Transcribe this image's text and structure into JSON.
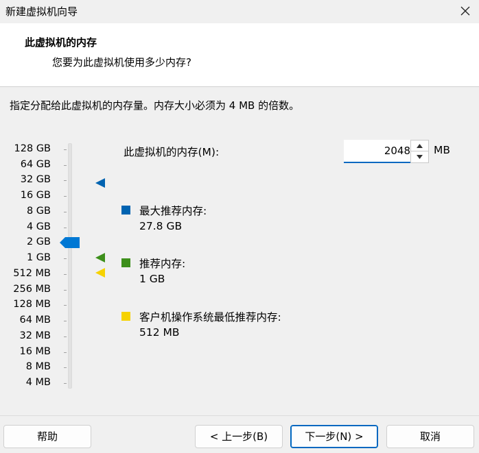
{
  "window": {
    "title": "新建虚拟机向导"
  },
  "header": {
    "title": "此虚拟机的内存",
    "subtitle": "您要为此虚拟机使用多少内存?"
  },
  "instruction": "指定分配给此虚拟机的内存量。内存大小必须为 4 MB 的倍数。",
  "scale": {
    "labels": [
      "128 GB",
      "64 GB",
      "32 GB",
      "16 GB",
      "8 GB",
      "4 GB",
      "2 GB",
      "1 GB",
      "512 MB",
      "256 MB",
      "128 MB",
      "64 MB",
      "32 MB",
      "16 MB",
      "8 MB",
      "4 MB"
    ],
    "selected": "2 GB"
  },
  "memory": {
    "label": "此虚拟机的内存(M):",
    "value": "2048",
    "unit": "MB"
  },
  "legend": {
    "max": {
      "label": "最大推荐内存:",
      "value": "27.8 GB",
      "color": "#0063b1"
    },
    "recommended": {
      "label": "推荐内存:",
      "value": "1 GB",
      "color": "#3d8f1b"
    },
    "guest_min": {
      "label": "客户机操作系统最低推荐内存:",
      "value": "512 MB",
      "color": "#f6d200"
    }
  },
  "buttons": {
    "help": "帮助",
    "back": "< 上一步(B)",
    "next": "下一步(N) >",
    "cancel": "取消"
  },
  "icons": {
    "close": "close-icon",
    "spin_up": "arrow-up-icon",
    "spin_down": "arrow-down-icon"
  },
  "slider_accent": "#0078d4"
}
